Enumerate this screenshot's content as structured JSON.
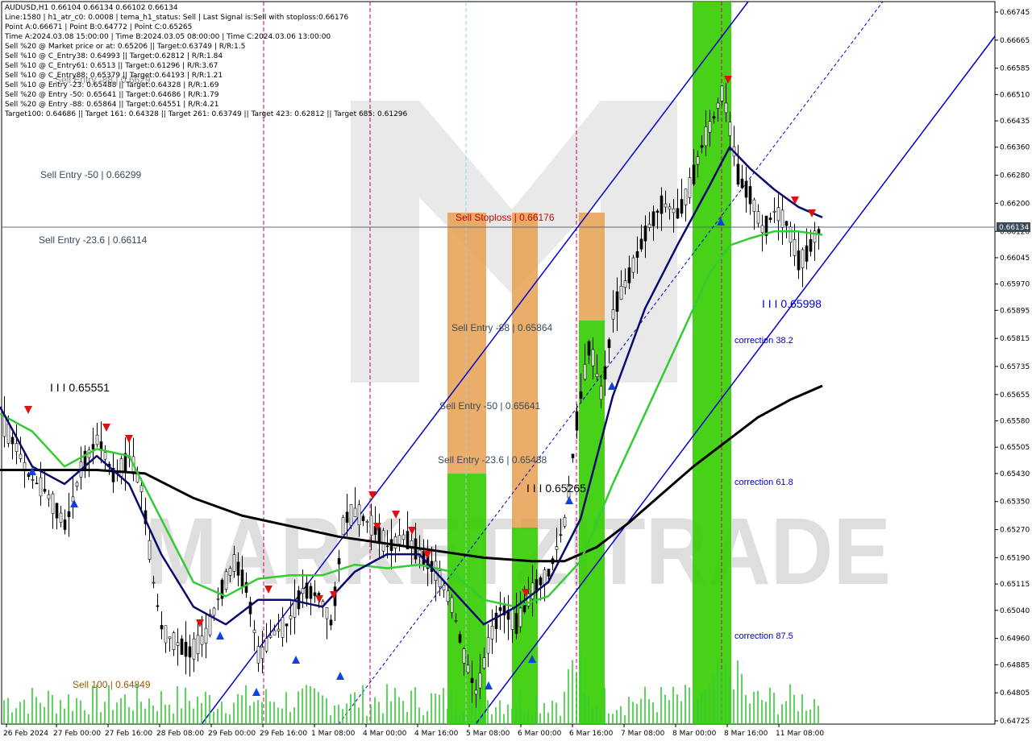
{
  "header": {
    "lines": [
      "AUDUSD,H1  0.66104 0.66134 0.66102 0.66134",
      "Line:1580 | h1_atr_c0: 0.0008 | tema_h1_status: Sell | Last Signal is:Sell with stoploss:0.66176",
      "Point A:0.66671 | Point B:0.64772 | Point C:0.65265",
      "Time A:2024.03.08 15:00:00 | Time B:2024.03.05 08:00:00 | Time C:2024.03.06 13:00:00",
      "Sell %20 @ Market price or at: 0.65206 || Target:0.63749 | R/R:1.5",
      "Sell %10 @ C_Entry38: 0.64993 || Target:0.62812 | R/R:1.84",
      "Sell %10 @ C_Entry61: 0.6513 || Target:0.61296 | R/R:3.67",
      "Sell %10 @ C_Entry88: 0.65379 || Target:0.64193 | R/R:1.21",
      "Sell %10 @ Entry -23: 0.65488 || Target:0.64328 | R/R:1.69",
      "Sell %20 @ Entry -50: 0.65641 || Target:0.64686 | R/R:1.79",
      "Sell %20 @ Entry -88: 0.65864 || Target:0.64551 | R/R:4.21",
      "Target100: 0.64686 || Target 161: 0.64328 || Target 261: 0.63749 || Target 423: 0.62812 || Target 685: 0.61296"
    ]
  },
  "annotations": {
    "sell_entry_neg50_top": "Sell Entry -50 | 0.66299",
    "sell_entry_neg236_top": "Sell Entry -23.6 | 0.66114",
    "sell_entry_faded": "Sell Entry -88 | 0.6629",
    "point_0_65551": "I I I 0.65551",
    "sell_stoploss": "Sell Stoploss | 0.66176",
    "sell_entry_neg88": "Sell Entry -88 | 0.65864",
    "sell_entry_neg50": "Sell Entry -50 | 0.65641",
    "sell_entry_neg236": "Sell Entry -23.6 | 0.65488",
    "point_0_65265": "I I I 0.65265",
    "point_0_65998": "I I I 0.65998",
    "correction_382": "correction 38.2",
    "correction_618": "correction 61.8",
    "correction_875": "correction 87.5",
    "sell_100": "Sell 100 | 0.64849",
    "watermark": "MARKETZITRADE"
  },
  "current_price": "0.66134",
  "colors": {
    "background": "#ffffff",
    "blue_line": "#0000cc",
    "navy_ma": "#0a0a6e",
    "green_ma": "#33cc33",
    "black_ma": "#000000",
    "green_zone": "#33cc00",
    "orange_zone": "#e8a050",
    "sell_arrow": "#e01010",
    "buy_arrow": "#1040e0",
    "magenta_vline": "#cc0066",
    "watermark": "#d8d8d8"
  },
  "chart_data": {
    "type": "candlestick",
    "symbol": "AUDUSD,H1",
    "y_ticks": [
      "0.66745",
      "0.66665",
      "0.66585",
      "0.66510",
      "0.66435",
      "0.66360",
      "0.66280",
      "0.66200",
      "0.66120",
      "0.66045",
      "0.65970",
      "0.65895",
      "0.65815",
      "0.65735",
      "0.65655",
      "0.65580",
      "0.65505",
      "0.65430",
      "0.65350",
      "0.65270",
      "0.65190",
      "0.65115",
      "0.65040",
      "0.64960",
      "0.64885",
      "0.64805",
      "0.64725"
    ],
    "x_ticks": [
      "26 Feb 2024",
      "27 Feb 00:00",
      "27 Feb 16:00",
      "28 Feb 08:00",
      "29 Feb 00:00",
      "29 Feb 16:00",
      "1 Mar 08:00",
      "4 Mar 00:00",
      "4 Mar 16:00",
      "5 Mar 08:00",
      "6 Mar 00:00",
      "6 Mar 16:00",
      "7 Mar 08:00",
      "8 Mar 00:00",
      "8 Mar 16:00",
      "11 Mar 08:00"
    ],
    "ylim": [
      0.64725,
      0.66765
    ],
    "price_path": [
      [
        0,
        0.6558
      ],
      [
        20,
        0.655
      ],
      [
        35,
        0.6542
      ],
      [
        55,
        0.6538
      ],
      [
        80,
        0.6528
      ],
      [
        100,
        0.6545
      ],
      [
        120,
        0.6553
      ],
      [
        140,
        0.6542
      ],
      [
        160,
        0.6548
      ],
      [
        175,
        0.6538
      ],
      [
        190,
        0.651
      ],
      [
        200,
        0.6498
      ],
      [
        215,
        0.6495
      ],
      [
        235,
        0.6492
      ],
      [
        255,
        0.6497
      ],
      [
        270,
        0.6508
      ],
      [
        290,
        0.6518
      ],
      [
        305,
        0.651
      ],
      [
        320,
        0.649
      ],
      [
        335,
        0.6497
      ],
      [
        355,
        0.65
      ],
      [
        375,
        0.651
      ],
      [
        395,
        0.6508
      ],
      [
        410,
        0.65
      ],
      [
        425,
        0.653
      ],
      [
        440,
        0.6532
      ],
      [
        460,
        0.6528
      ],
      [
        480,
        0.6522
      ],
      [
        500,
        0.6525
      ],
      [
        520,
        0.652
      ],
      [
        540,
        0.6515
      ],
      [
        560,
        0.6505
      ],
      [
        575,
        0.649
      ],
      [
        590,
        0.648
      ],
      [
        605,
        0.6495
      ],
      [
        620,
        0.6505
      ],
      [
        640,
        0.65
      ],
      [
        660,
        0.651
      ],
      [
        680,
        0.6515
      ],
      [
        700,
        0.653
      ],
      [
        715,
        0.656
      ],
      [
        730,
        0.658
      ],
      [
        745,
        0.6565
      ],
      [
        760,
        0.659
      ],
      [
        780,
        0.66
      ],
      [
        800,
        0.6612
      ],
      [
        820,
        0.662
      ],
      [
        840,
        0.6617
      ],
      [
        855,
        0.6625
      ],
      [
        870,
        0.6637
      ],
      [
        885,
        0.6645
      ],
      [
        895,
        0.6652
      ],
      [
        905,
        0.664
      ],
      [
        915,
        0.6627
      ],
      [
        930,
        0.6622
      ],
      [
        945,
        0.6612
      ],
      [
        960,
        0.6618
      ],
      [
        975,
        0.6614
      ],
      [
        990,
        0.6603
      ],
      [
        1000,
        0.6606
      ],
      [
        1010,
        0.6611
      ],
      [
        1020,
        0.66134
      ]
    ],
    "ma_navy": [
      [
        0,
        0.6562
      ],
      [
        40,
        0.6545
      ],
      [
        80,
        0.654
      ],
      [
        120,
        0.6548
      ],
      [
        160,
        0.654
      ],
      [
        200,
        0.652
      ],
      [
        240,
        0.6505
      ],
      [
        280,
        0.65
      ],
      [
        320,
        0.6507
      ],
      [
        360,
        0.6507
      ],
      [
        400,
        0.6505
      ],
      [
        440,
        0.6515
      ],
      [
        480,
        0.652
      ],
      [
        520,
        0.652
      ],
      [
        560,
        0.651
      ],
      [
        600,
        0.65
      ],
      [
        640,
        0.6505
      ],
      [
        680,
        0.6512
      ],
      [
        720,
        0.653
      ],
      [
        760,
        0.6565
      ],
      [
        800,
        0.659
      ],
      [
        840,
        0.6608
      ],
      [
        880,
        0.6625
      ],
      [
        905,
        0.6636
      ],
      [
        930,
        0.663
      ],
      [
        960,
        0.6624
      ],
      [
        990,
        0.6619
      ],
      [
        1020,
        0.6616
      ]
    ],
    "ma_green": [
      [
        0,
        0.656
      ],
      [
        40,
        0.6555
      ],
      [
        80,
        0.6545
      ],
      [
        120,
        0.655
      ],
      [
        160,
        0.6548
      ],
      [
        200,
        0.653
      ],
      [
        240,
        0.6512
      ],
      [
        280,
        0.6508
      ],
      [
        320,
        0.6513
      ],
      [
        360,
        0.6514
      ],
      [
        400,
        0.6514
      ],
      [
        440,
        0.6517
      ],
      [
        480,
        0.6516
      ],
      [
        520,
        0.6517
      ],
      [
        560,
        0.6515
      ],
      [
        600,
        0.6507
      ],
      [
        640,
        0.6505
      ],
      [
        680,
        0.6508
      ],
      [
        720,
        0.6518
      ],
      [
        760,
        0.654
      ],
      [
        800,
        0.656
      ],
      [
        840,
        0.658
      ],
      [
        880,
        0.66
      ],
      [
        905,
        0.6608
      ],
      [
        930,
        0.661
      ],
      [
        960,
        0.6612
      ],
      [
        990,
        0.6612
      ],
      [
        1020,
        0.6611
      ]
    ],
    "ma_black": [
      [
        0,
        0.6544
      ],
      [
        60,
        0.6544
      ],
      [
        120,
        0.6544
      ],
      [
        180,
        0.6543
      ],
      [
        240,
        0.6536
      ],
      [
        300,
        0.6531
      ],
      [
        360,
        0.6528
      ],
      [
        420,
        0.6525
      ],
      [
        480,
        0.6523
      ],
      [
        540,
        0.6521
      ],
      [
        600,
        0.6519
      ],
      [
        660,
        0.6518
      ],
      [
        700,
        0.6518
      ],
      [
        740,
        0.6522
      ],
      [
        780,
        0.6529
      ],
      [
        820,
        0.6537
      ],
      [
        860,
        0.6545
      ],
      [
        900,
        0.6552
      ],
      [
        940,
        0.6559
      ],
      [
        980,
        0.6564
      ],
      [
        1020,
        0.6568
      ]
    ],
    "volume_peak_note": "volume histogram bars shown in green along the bottom"
  }
}
